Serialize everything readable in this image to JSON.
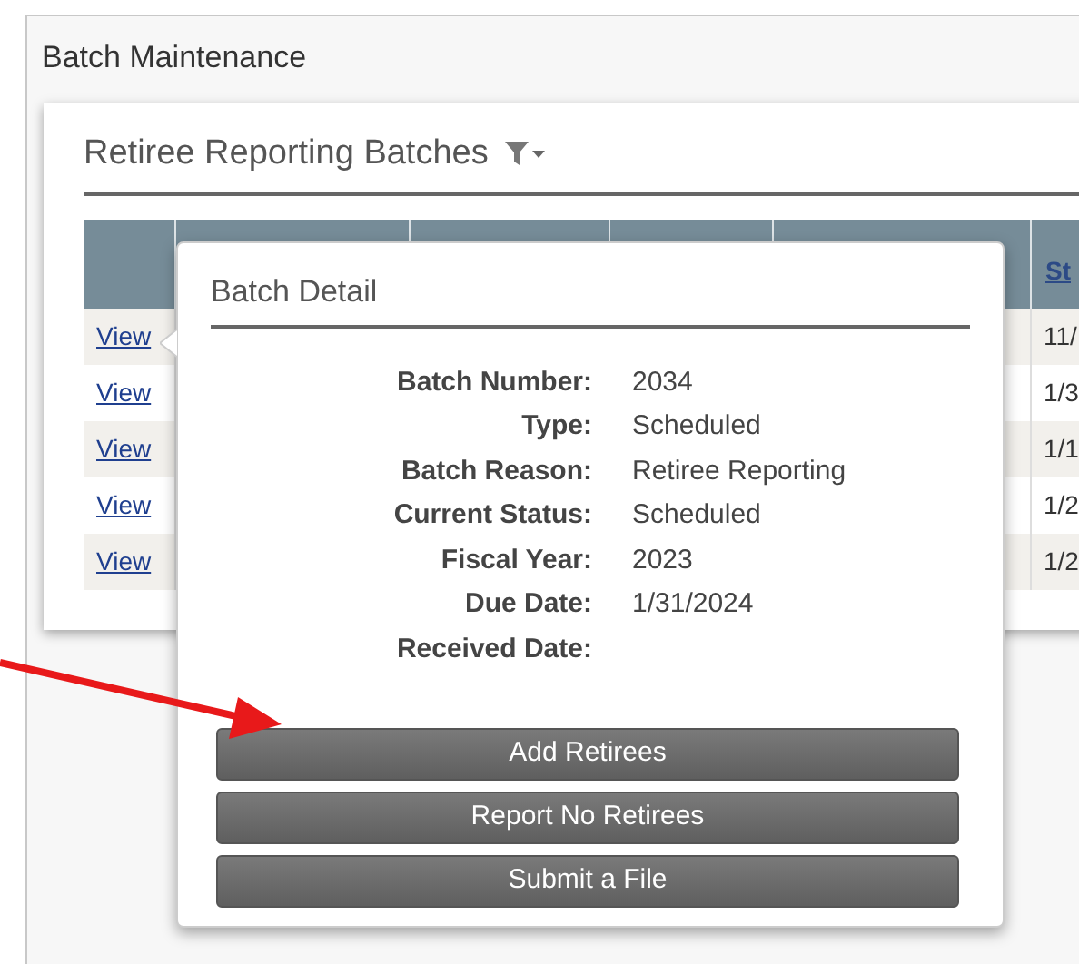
{
  "page_title": "Batch Maintenance",
  "section": {
    "title": "Retiree Reporting Batches"
  },
  "table": {
    "column_6_header": "St",
    "rows": [
      {
        "link": "View",
        "column_6": "11/"
      },
      {
        "link": "View",
        "column_6": "1/3"
      },
      {
        "link": "View",
        "column_6": "1/1"
      },
      {
        "link": "View",
        "column_6": "1/2"
      },
      {
        "link": "View",
        "column_6": "1/2"
      }
    ]
  },
  "popover": {
    "title": "Batch Detail",
    "fields": [
      {
        "label": "Batch Number:",
        "value": "2034"
      },
      {
        "label": "Type:",
        "value": "Scheduled"
      },
      {
        "label": "Batch Reason:",
        "value": "Retiree Reporting"
      },
      {
        "label": "Current Status:",
        "value": "Scheduled"
      },
      {
        "label": "Fiscal Year:",
        "value": "2023"
      },
      {
        "label": "Due Date:",
        "value": "1/31/2024"
      },
      {
        "label": "Received Date:"
      }
    ],
    "buttons": [
      "Add Retirees",
      "Report No Retirees",
      "Submit a File"
    ]
  }
}
